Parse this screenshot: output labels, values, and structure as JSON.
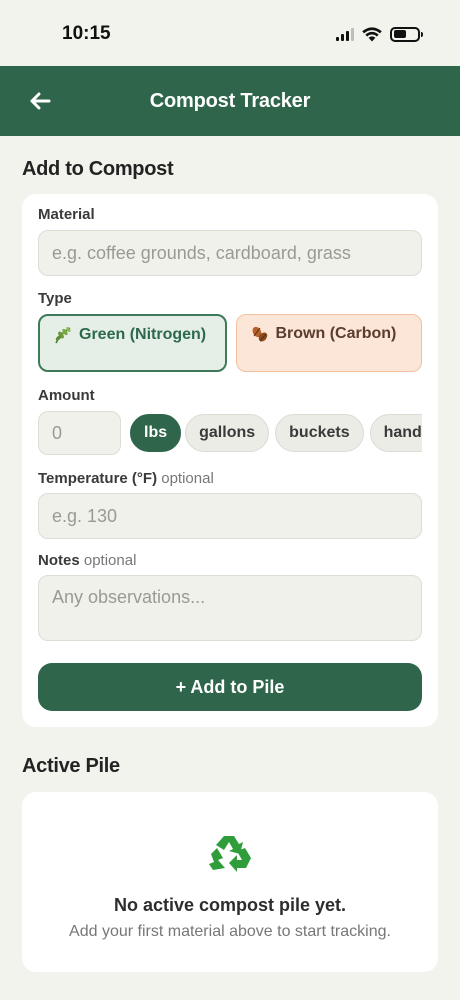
{
  "status_bar": {
    "time": "10:15"
  },
  "app_bar": {
    "title": "Compost Tracker",
    "back_icon": "arrow-left-icon"
  },
  "add_section": {
    "title": "Add to Compost",
    "material": {
      "label": "Material",
      "placeholder": "e.g. coffee grounds, cardboard, grass",
      "value": ""
    },
    "type": {
      "label": "Type",
      "options": [
        {
          "label": "Green (Nitrogen)",
          "icon": "leaf-icon",
          "selected": true
        },
        {
          "label": "Brown (Carbon)",
          "icon": "dry-leaves-icon",
          "selected": false
        }
      ]
    },
    "amount": {
      "label": "Amount",
      "placeholder": "0",
      "units": [
        {
          "label": "lbs",
          "selected": true
        },
        {
          "label": "gallons",
          "selected": false
        },
        {
          "label": "buckets",
          "selected": false
        },
        {
          "label": "handfuls",
          "selected": false
        }
      ]
    },
    "temperature": {
      "label": "Temperature (°F)",
      "optional": "optional",
      "placeholder": "e.g. 130"
    },
    "notes": {
      "label": "Notes",
      "optional": "optional",
      "placeholder": "Any observations..."
    },
    "submit_label": "+ Add to Pile"
  },
  "active_pile": {
    "title": "Active Pile",
    "empty_icon": "recycle-icon",
    "empty_title": "No active compost pile yet.",
    "empty_subtitle": "Add your first material above to start tracking."
  },
  "colors": {
    "primary": "#2e654b",
    "green_bg": "#e5efe8",
    "brown_bg": "#fbe6d8",
    "background": "#f3f3ee"
  }
}
